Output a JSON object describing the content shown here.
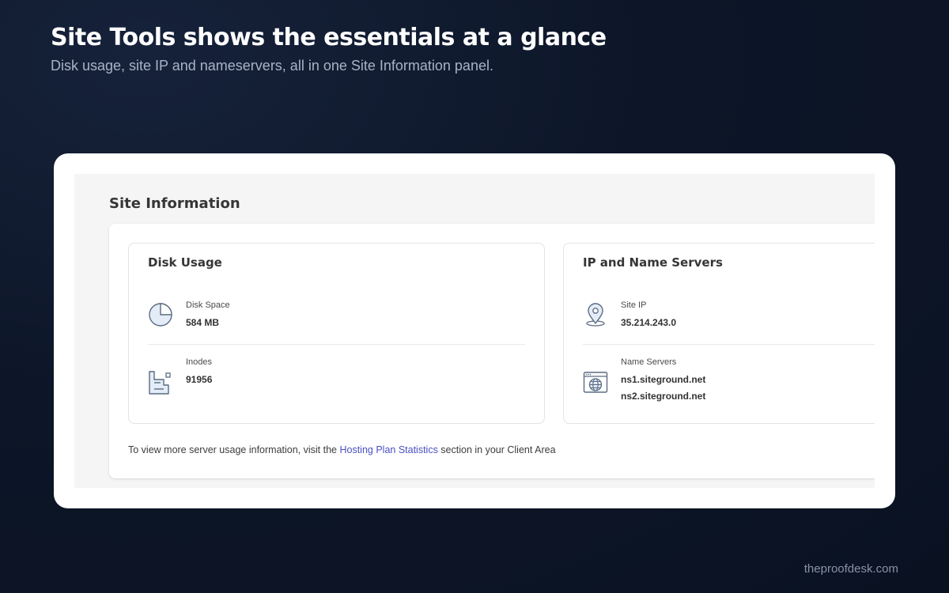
{
  "headline": "Site Tools shows the essentials at a glance",
  "subhead": "Disk usage, site IP and nameservers, all in one Site Information panel.",
  "site_info": {
    "title": "Site Information",
    "disk_usage": {
      "title": "Disk Usage",
      "disk_space": {
        "icon": "pie-chart-icon",
        "label": "Disk Space",
        "value": "584 MB"
      },
      "inodes": {
        "icon": "inodes-icon",
        "label": "Inodes",
        "value": "91956"
      }
    },
    "ip_ns": {
      "title": "IP and Name Servers",
      "site_ip": {
        "icon": "location-pin-icon",
        "label": "Site IP",
        "value": "35.214.243.0"
      },
      "name_servers": {
        "icon": "globe-browser-icon",
        "label": "Name Servers",
        "values": [
          "ns1.siteground.net",
          "ns2.siteground.net"
        ]
      }
    },
    "footnote": {
      "prefix": "To view more server usage information, visit the ",
      "link": "Hosting Plan Statistics",
      "suffix": " section in your Client Area"
    }
  },
  "brand": "theproofdesk.com"
}
